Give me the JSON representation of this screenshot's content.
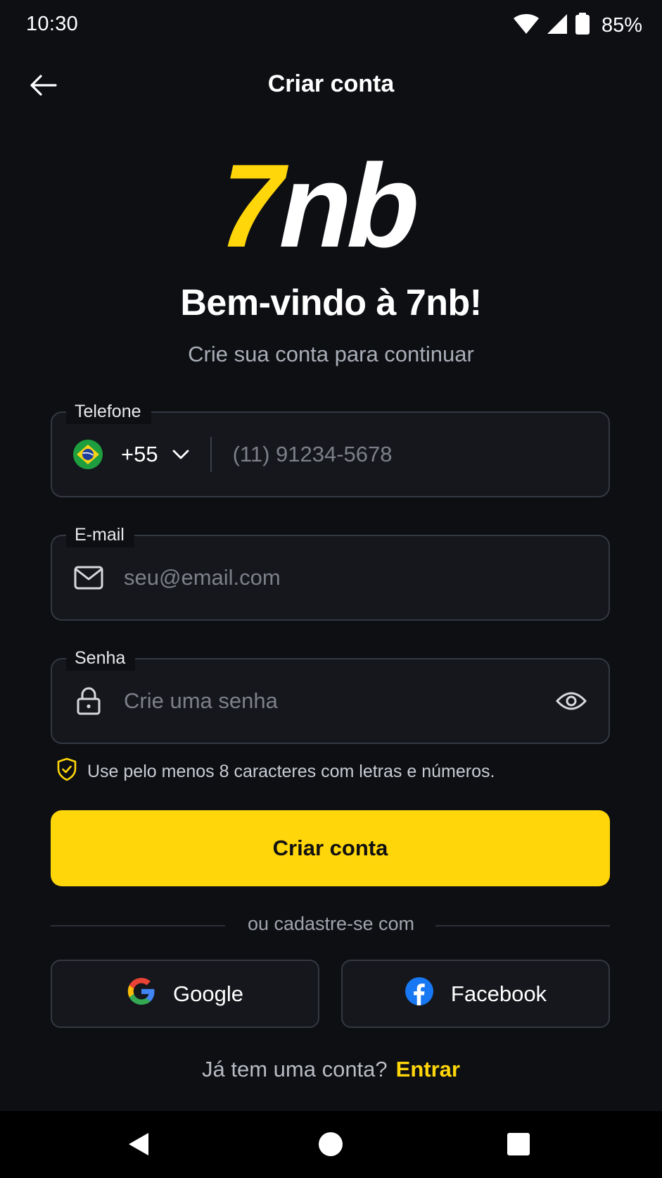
{
  "status_bar": {
    "time": "10:30",
    "battery_percent": "85%",
    "icons": [
      "wifi-icon",
      "signal-icon",
      "battery-icon"
    ]
  },
  "header": {
    "title": "Criar conta",
    "back_icon": "arrow-left-icon"
  },
  "logo": {
    "text_seven": "7",
    "text_nb": "nb",
    "colors": {
      "seven": "#ffd60a",
      "nb": "#ffffff"
    }
  },
  "welcome": {
    "title": "Bem-vindo à 7nb!",
    "subtitle": "Crie sua conta para continuar"
  },
  "form": {
    "phone": {
      "label": "Telefone",
      "country_flag": "brazil-flag-icon",
      "dial_code": "+55",
      "placeholder": "(11) 91234-5678",
      "value": ""
    },
    "email": {
      "label": "E-mail",
      "icon": "mail-icon",
      "placeholder": "seu@email.com",
      "value": ""
    },
    "password": {
      "label": "Senha",
      "icon": "lock-icon",
      "toggle_icon": "eye-icon",
      "placeholder": "Crie uma senha",
      "value": ""
    },
    "hint": "Use pelo menos 8 caracteres com letras e números.",
    "submit_label": "Criar conta"
  },
  "social": {
    "divider_text": "ou cadastre-se com",
    "google_label": "Google",
    "facebook_label": "Facebook"
  },
  "footer": {
    "prompt": "Já tem uma conta?",
    "link": "Entrar"
  },
  "theme": {
    "background": "#0d0f13",
    "accent": "#ffd60a",
    "field_border": "#343841"
  }
}
